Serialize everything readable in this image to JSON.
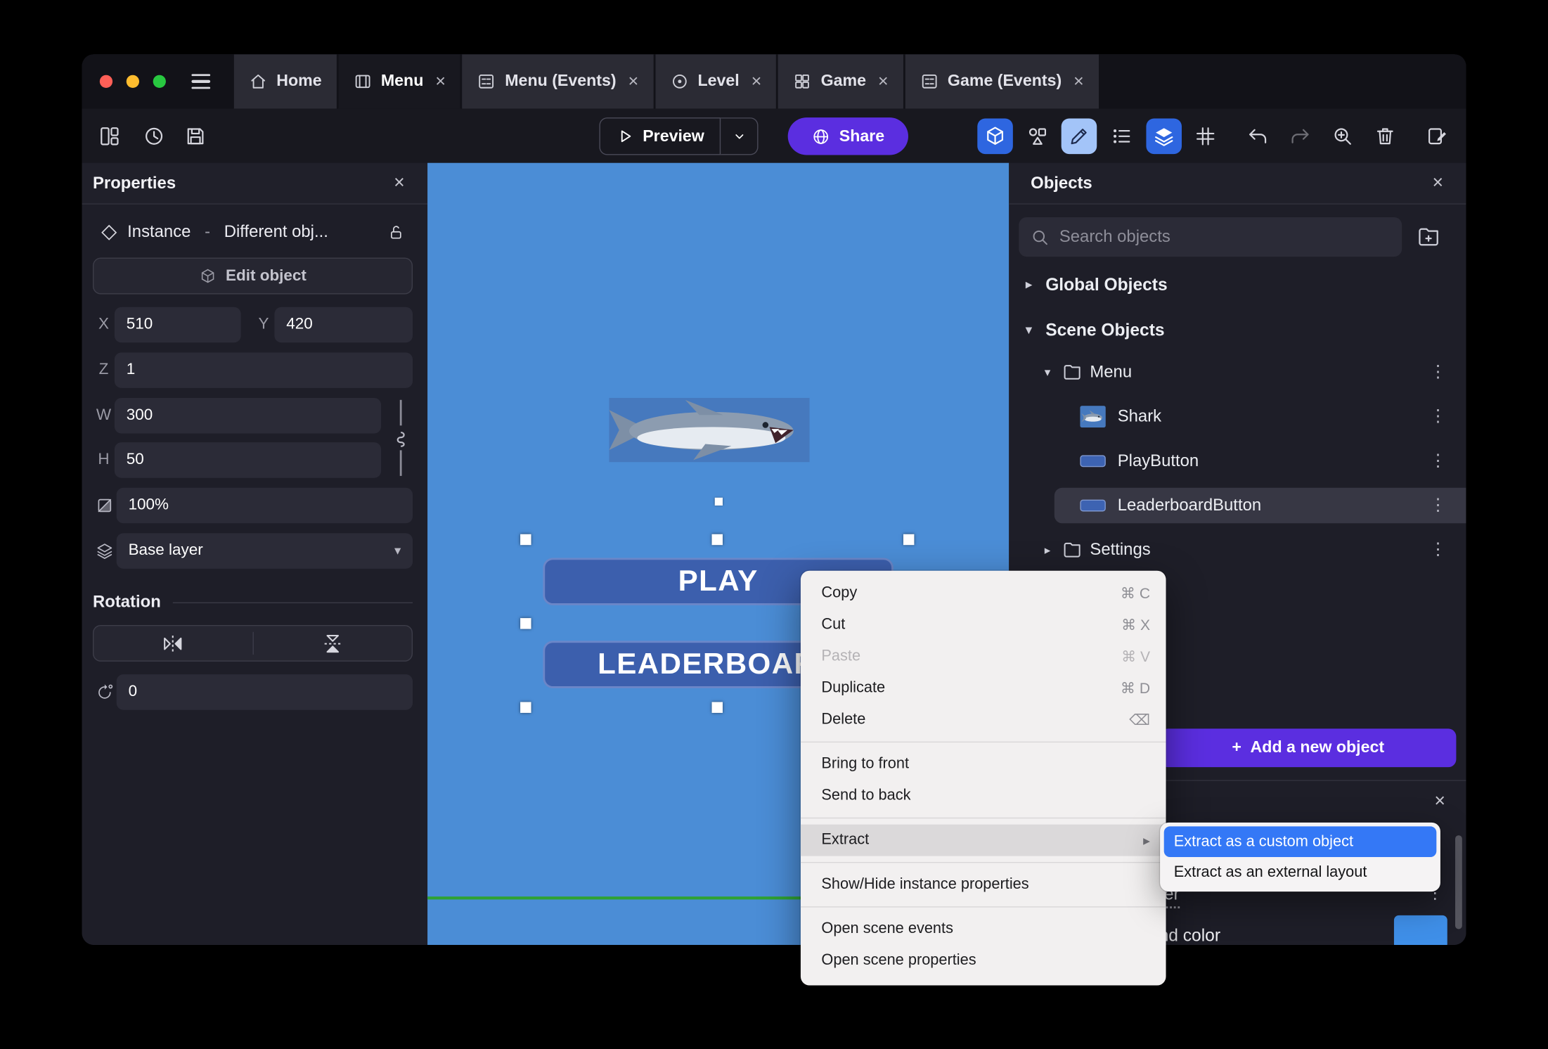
{
  "window": {
    "tabs": [
      {
        "label": "Home"
      },
      {
        "label": "Menu"
      },
      {
        "label": "Menu (Events)"
      },
      {
        "label": "Level"
      },
      {
        "label": "Game"
      },
      {
        "label": "Game (Events)"
      }
    ]
  },
  "toolbar": {
    "preview": "Preview",
    "share": "Share"
  },
  "properties": {
    "title": "Properties",
    "instance_type": "Instance",
    "dash": "-",
    "instance_object": "Different obj...",
    "edit_object": "Edit object",
    "x_label": "X",
    "x": "510",
    "y_label": "Y",
    "y": "420",
    "z_label": "Z",
    "z": "1",
    "w_label": "W",
    "w": "300",
    "h_label": "H",
    "h": "50",
    "opacity": "100%",
    "layer": "Base layer",
    "rotation_title": "Rotation",
    "rotation": "0"
  },
  "canvas": {
    "play": "PLAY",
    "leaderboard": "LEADERBOARD"
  },
  "context_menu": {
    "copy": {
      "label": "Copy",
      "shortcut": "⌘ C"
    },
    "cut": {
      "label": "Cut",
      "shortcut": "⌘ X"
    },
    "paste": {
      "label": "Paste",
      "shortcut": "⌘ V"
    },
    "duplicate": {
      "label": "Duplicate",
      "shortcut": "⌘ D"
    },
    "delete": {
      "label": "Delete",
      "shortcut": "⌫"
    },
    "bring_to_front": "Bring to front",
    "send_to_back": "Send to back",
    "extract": "Extract",
    "show_hide": "Show/Hide instance properties",
    "open_scene_events": "Open scene events",
    "open_scene_properties": "Open scene properties",
    "submenu": {
      "custom_object": "Extract as a custom object",
      "external_layout": "Extract as an external layout"
    }
  },
  "objects": {
    "title": "Objects",
    "search_placeholder": "Search objects",
    "global_objects": "Global Objects",
    "scene_objects": "Scene Objects",
    "items": [
      {
        "label": "Menu"
      },
      {
        "label": "Shark"
      },
      {
        "label": "PlayButton"
      },
      {
        "label": "LeaderboardButton"
      },
      {
        "label": "Settings"
      }
    ],
    "add_button": "Add a new object"
  },
  "layers_panel": {
    "layer_name": "Base layer",
    "background_color_label": "Background color",
    "swatch_color": "#3f8fe8"
  },
  "colors": {
    "canvas_blue": "#4b8dd6",
    "accent_purple": "#5b2ee0",
    "selection_blue": "#3478f6",
    "game_button_blue": "#3c5fad",
    "traffic_red": "#ff5f57",
    "traffic_yellow": "#febc2e",
    "traffic_green": "#28c840"
  },
  "icons": {
    "close": "×",
    "overflow_menu": "⋮",
    "chevron_right": "▸",
    "chevron_down": "▾",
    "submenu_arrow": "▸",
    "plus": "+"
  }
}
